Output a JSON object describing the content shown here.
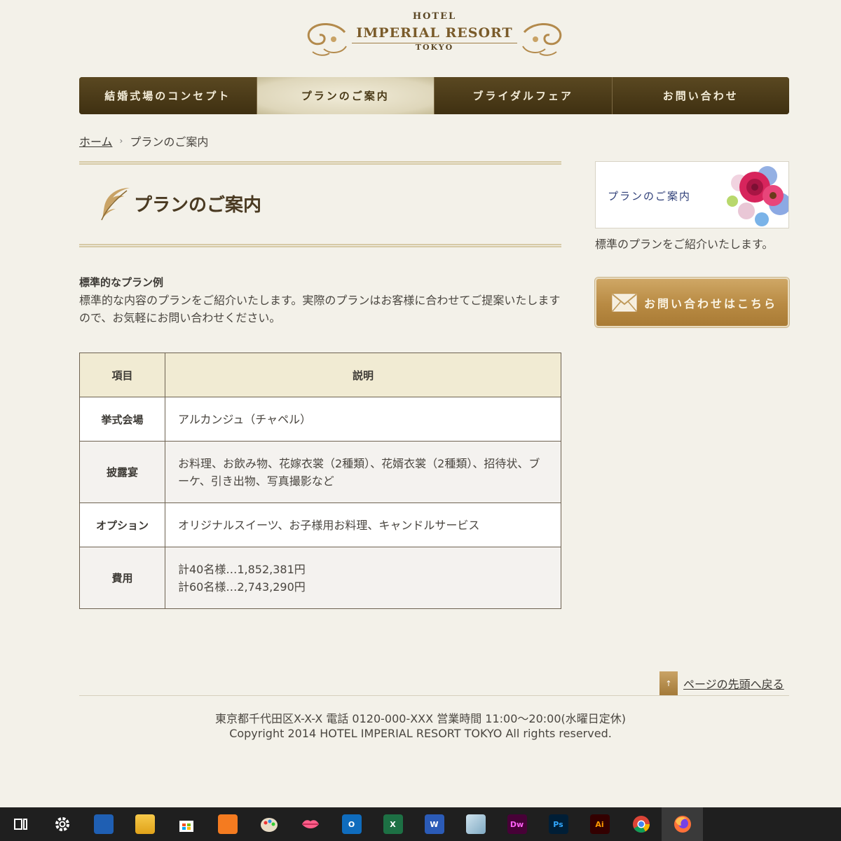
{
  "logo": {
    "hotel": "HOTEL",
    "name": "IMPERIAL RESORT",
    "city": "TOKYO"
  },
  "nav": {
    "items": [
      {
        "label": "結婚式場のコンセプト"
      },
      {
        "label": "プランのご案内"
      },
      {
        "label": "ブライダルフェア"
      },
      {
        "label": "お問い合わせ"
      }
    ],
    "active_index": 1
  },
  "breadcrumb": {
    "home": "ホーム",
    "sep": "›",
    "current": "プランのご案内"
  },
  "page": {
    "title": "プランのご案内"
  },
  "intro": {
    "heading": "標準的なプラン例",
    "text": "標準的な内容のプランをご紹介いたします。実際のプランはお客様に合わせてご提案いたしますので、お気軽にお問い合わせください。"
  },
  "table": {
    "headers": [
      "項目",
      "説明"
    ],
    "rows": [
      {
        "label": "挙式会場",
        "value": "アルカンジュ（チャペル）"
      },
      {
        "label": "披露宴",
        "value": "お料理、お飲み物、花嫁衣裳（2種類）、花婿衣裳（2種類）、招待状、ブーケ、引き出物、写真撮影など"
      },
      {
        "label": "オプション",
        "value": "オリジナルスイーツ、お子様用お料理、キャンドルサービス"
      },
      {
        "label": "費用",
        "lines": [
          "計40名様…1,852,381円",
          "計60名様…2,743,290円"
        ]
      }
    ]
  },
  "sidebar": {
    "banner_label": "プランのご案内",
    "caption": "標準のプランをご紹介いたします。",
    "contact_button": "お問い合わせはこちら"
  },
  "footer": {
    "to_top": "ページの先頭へ戻る",
    "to_top_arrow": "↑",
    "address": "東京都千代田区X-X-X 電話 0120-000-XXX 営業時間 11:00～20:00(水曜日定休)",
    "copyright": "Copyright 2014 HOTEL IMPERIAL RESORT TOKYO All rights reserved."
  },
  "taskbar": {
    "apps": [
      {
        "icon": "task-view-icon"
      },
      {
        "icon": "settings-gear-icon"
      },
      {
        "icon": "game-bar-icon"
      },
      {
        "icon": "file-explorer-icon"
      },
      {
        "icon": "microsoft-store-icon"
      },
      {
        "icon": "xampp-icon"
      },
      {
        "icon": "paint-palette-icon"
      },
      {
        "icon": "lips-app-icon"
      },
      {
        "icon": "outlook-icon",
        "text": "O"
      },
      {
        "icon": "excel-icon",
        "text": "X"
      },
      {
        "icon": "word-icon",
        "text": "W"
      },
      {
        "icon": "glass-app-icon"
      },
      {
        "icon": "dreamweaver-icon",
        "text": "Dw"
      },
      {
        "icon": "photoshop-icon",
        "text": "Ps"
      },
      {
        "icon": "illustrator-icon",
        "text": "Ai"
      },
      {
        "icon": "chrome-icon"
      },
      {
        "icon": "firefox-icon"
      }
    ],
    "active_index": 16
  },
  "colors": {
    "background": "#f3f1e9",
    "nav_dark": "#4a3a17",
    "gold": "#b88a43",
    "table_header": "#f1ebd3"
  }
}
